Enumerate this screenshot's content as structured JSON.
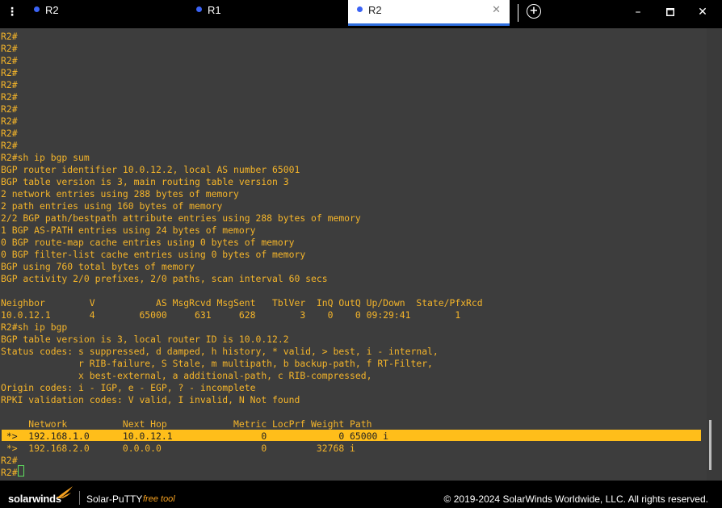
{
  "tabs": [
    {
      "label": "R2",
      "active": false
    },
    {
      "label": "R1",
      "active": false
    },
    {
      "label": "R2",
      "active": true
    }
  ],
  "icons": {
    "menu": "vertical-dots-icon",
    "close_tab": "close-icon",
    "add_tab": "plus-circle-icon",
    "minimize": "minimize-icon",
    "maximize": "maximize-icon",
    "close_window": "close-icon"
  },
  "colors": {
    "terminal_bg": "#3d3d3d",
    "terminal_text": "#f5b52a",
    "highlight": "#ffbe1a",
    "tab_dot": "#3b63f5",
    "active_tab_underline": "#2f6fe0",
    "brand_accent": "#f4a020"
  },
  "terminal": {
    "lines": [
      "R2#",
      "R2#",
      "R2#",
      "R2#",
      "R2#",
      "R2#",
      "R2#",
      "R2#",
      "R2#",
      "R2#",
      "R2#sh ip bgp sum",
      "BGP router identifier 10.0.12.2, local AS number 65001",
      "BGP table version is 3, main routing table version 3",
      "2 network entries using 288 bytes of memory",
      "2 path entries using 160 bytes of memory",
      "2/2 BGP path/bestpath attribute entries using 288 bytes of memory",
      "1 BGP AS-PATH entries using 24 bytes of memory",
      "0 BGP route-map cache entries using 0 bytes of memory",
      "0 BGP filter-list cache entries using 0 bytes of memory",
      "BGP using 760 total bytes of memory",
      "BGP activity 2/0 prefixes, 2/0 paths, scan interval 60 secs",
      "",
      "Neighbor        V           AS MsgRcvd MsgSent   TblVer  InQ OutQ Up/Down  State/PfxRcd",
      "10.0.12.1       4        65000     631     628        3    0    0 09:29:41        1",
      "R2#sh ip bgp",
      "BGP table version is 3, local router ID is 10.0.12.2",
      "Status codes: s suppressed, d damped, h history, * valid, > best, i - internal,",
      "              r RIB-failure, S Stale, m multipath, b backup-path, f RT-Filter,",
      "              x best-external, a additional-path, c RIB-compressed,",
      "Origin codes: i - IGP, e - EGP, ? - incomplete",
      "RPKI validation codes: V valid, I invalid, N Not found",
      "",
      "     Network          Next Hop            Metric LocPrf Weight Path",
      " *>  192.168.1.0      10.0.12.1                0             0 65000 i",
      " *>  192.168.2.0      0.0.0.0                  0         32768 i",
      "R2#",
      "R2#"
    ],
    "highlighted_line_index": 33
  },
  "footer": {
    "brand": "solarwinds",
    "product": "Solar-PuTTY",
    "free_label": "free tool",
    "copyright": "© 2019-2024 SolarWinds Worldwide, LLC. All rights reserved."
  }
}
